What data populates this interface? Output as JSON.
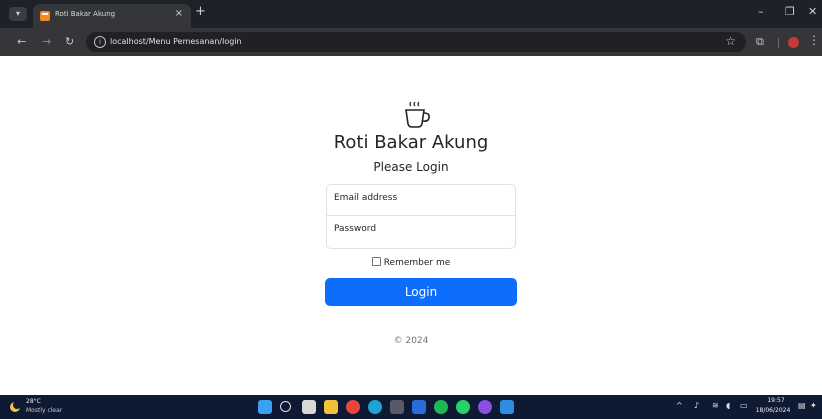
{
  "browser": {
    "tab_title": "Roti Bakar Akung",
    "tab_close": "×",
    "new_tab": "+",
    "url": "localhost/Menu Pemesanan/login",
    "minimize": "–",
    "maximize": "❐",
    "close": "✕"
  },
  "page": {
    "brand": "Roti Bakar Akung",
    "subtitle": "Please Login",
    "email_placeholder": "Email address",
    "password_placeholder": "Password",
    "remember_label": "Remember me",
    "login_label": "Login",
    "footer": "© 2024",
    "accent_color": "#0d6efd"
  },
  "taskbar": {
    "weather_temp": "28°C",
    "weather_desc": "Mostly clear",
    "time": "19:57",
    "date": "18/06/2024",
    "apps": [
      "start-icon",
      "search-icon",
      "task-view-icon",
      "file-explorer-icon",
      "chrome-icon",
      "edge-icon",
      "calculator-icon",
      "store-icon",
      "spotify-icon",
      "whatsapp-icon",
      "browser-icon",
      "vscode-icon"
    ]
  }
}
